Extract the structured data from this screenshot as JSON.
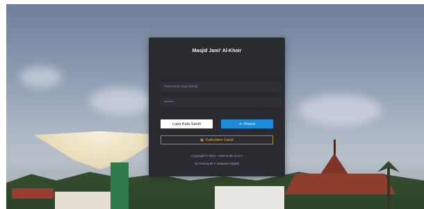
{
  "app": {
    "title": "Masjid Jami' Al-Khoir"
  },
  "form": {
    "username_placeholder": "Username atau Email",
    "password_value": "••••••••",
    "forgot_label": "Lupa Kata Sandi",
    "login_label": "Masuk",
    "login_icon": "login-icon",
    "calc_label": "Kalkulator Zakat",
    "calc_icon": "calculator-icon"
  },
  "footer": {
    "copyright": "Copyright © 2021 - SIMASJID v1.5.3",
    "credit": "by Kelompok 2 Sekawan Digital"
  },
  "colors": {
    "card": "#2a2b31",
    "login": "#1e8cd8",
    "calc_border": "#b88a1f"
  }
}
